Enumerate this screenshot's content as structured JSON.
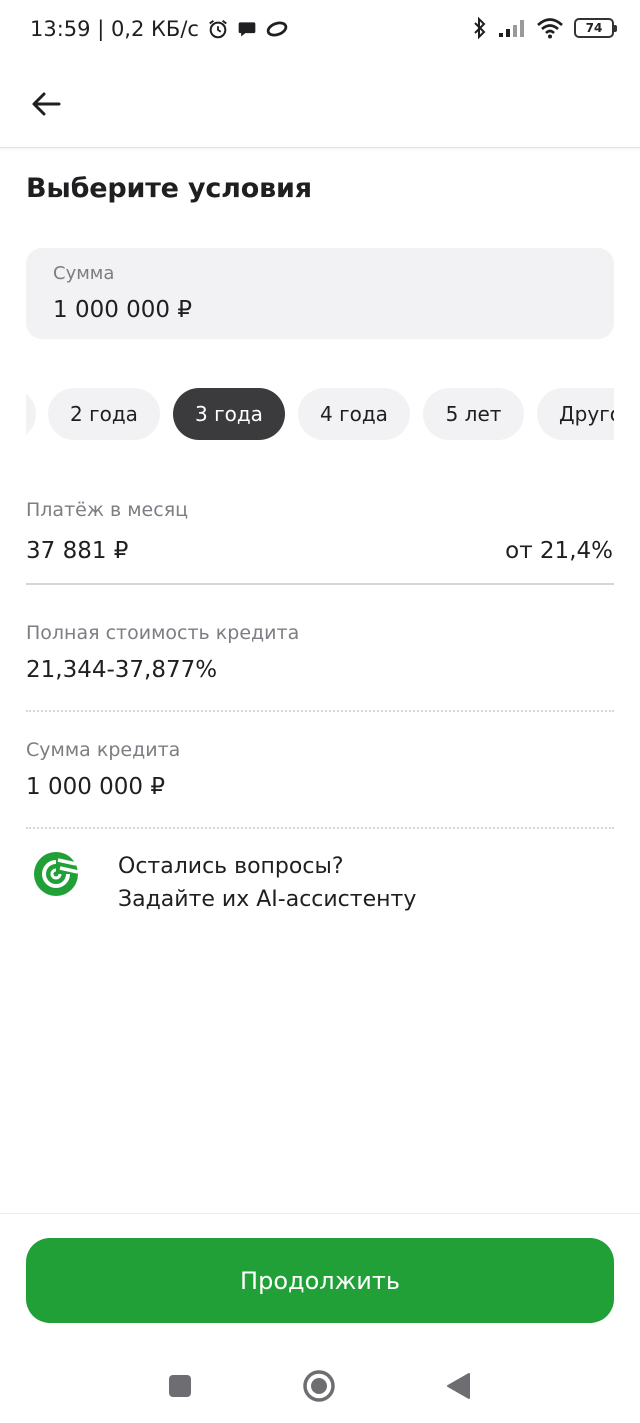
{
  "status_bar": {
    "time_speed": "13:59 | 0,2 КБ/с",
    "battery": "74"
  },
  "page": {
    "title": "Выберите условия"
  },
  "amount": {
    "label": "Сумма",
    "value": "1 000 000 ₽"
  },
  "terms": {
    "selected_index": 2,
    "chips": [
      {
        "label": ""
      },
      {
        "label": "2 года"
      },
      {
        "label": "3 года"
      },
      {
        "label": "4 года"
      },
      {
        "label": "5 лет"
      },
      {
        "label": "Другой"
      }
    ]
  },
  "monthly_payment": {
    "label": "Платёж в месяц",
    "value": "37 881 ₽",
    "rate": "от 21,4%"
  },
  "full_cost": {
    "label": "Полная стоимость кредита",
    "value": "21,344-37,877%"
  },
  "credit_sum": {
    "label": "Сумма кредита",
    "value": "1 000 000 ₽"
  },
  "assistant": {
    "line1": "Остались вопросы?",
    "line2": "Задайте их AI-ассистенту"
  },
  "actions": {
    "continue_label": "Продолжить"
  },
  "colors": {
    "accent_green": "#21a038",
    "chip_selected": "#3b3b3d",
    "chip_default": "#f2f2f4"
  },
  "icons": {
    "back": "arrow-left-icon",
    "assistant_logo": "sber-logo-icon",
    "nav_recents": "square-icon",
    "nav_home": "circle-icon",
    "nav_back": "triangle-back-icon"
  }
}
